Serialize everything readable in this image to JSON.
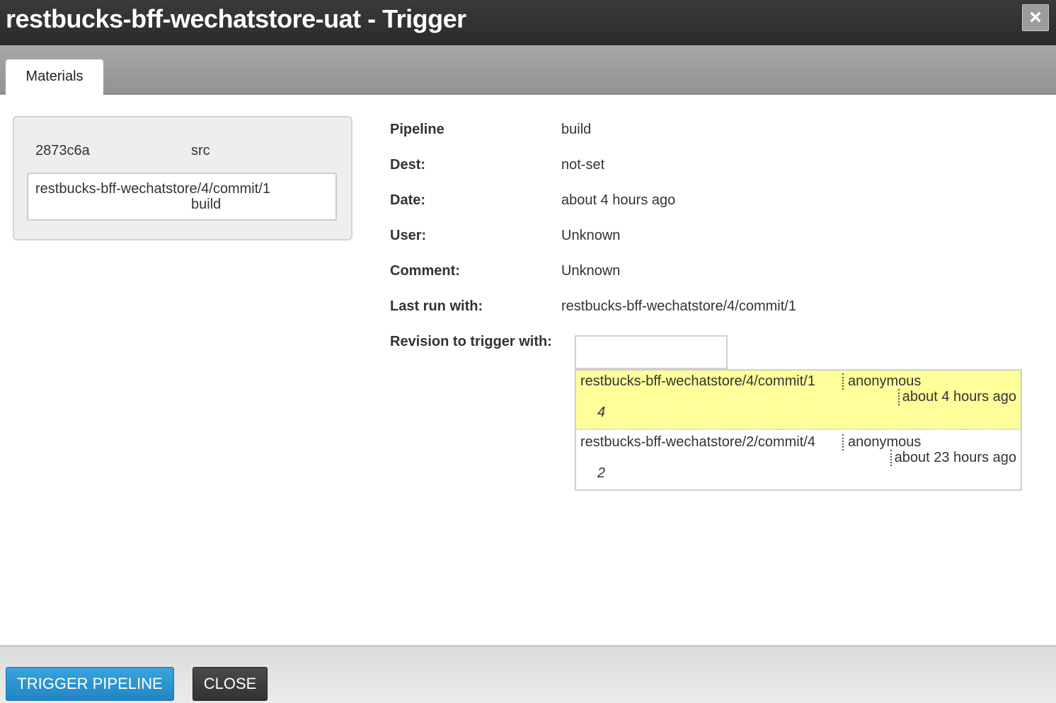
{
  "dialog": {
    "title": "restbucks-bff-wechatstore-uat - Trigger",
    "close_icon": "×"
  },
  "tabs": [
    {
      "label": "Materials"
    }
  ],
  "material": {
    "revision": "2873c6a",
    "folder": "src",
    "selected_revision": "restbucks-bff-wechatstore/4/commit/1",
    "selected_name": "build"
  },
  "details": {
    "pipeline_label": "Pipeline",
    "pipeline_value": "build",
    "dest_label": "Dest:",
    "dest_value": "not-set",
    "date_label": "Date:",
    "date_value": "about 4 hours ago",
    "user_label": "User:",
    "user_value": "Unknown",
    "comment_label": "Comment:",
    "comment_value": "Unknown",
    "last_run_label": "Last run with:",
    "last_run_value": "restbucks-bff-wechatstore/4/commit/1",
    "revision_label": "Revision to trigger with:",
    "revision_input_value": ""
  },
  "suggestions": [
    {
      "revision": "restbucks-bff-wechatstore/4/commit/1",
      "user": "anonymous",
      "time": "about 4 hours ago",
      "label": "4",
      "highlighted": true
    },
    {
      "revision": "restbucks-bff-wechatstore/2/commit/4",
      "user": "anonymous",
      "time": "about 23 hours ago",
      "label": "2",
      "highlighted": false
    }
  ],
  "footer": {
    "trigger_label": "TRIGGER PIPELINE",
    "close_label": "CLOSE"
  },
  "colors": {
    "accent_blue": "#2185c5",
    "highlight_yellow": "#ffff99",
    "titlebar": "#2b2b2b"
  }
}
